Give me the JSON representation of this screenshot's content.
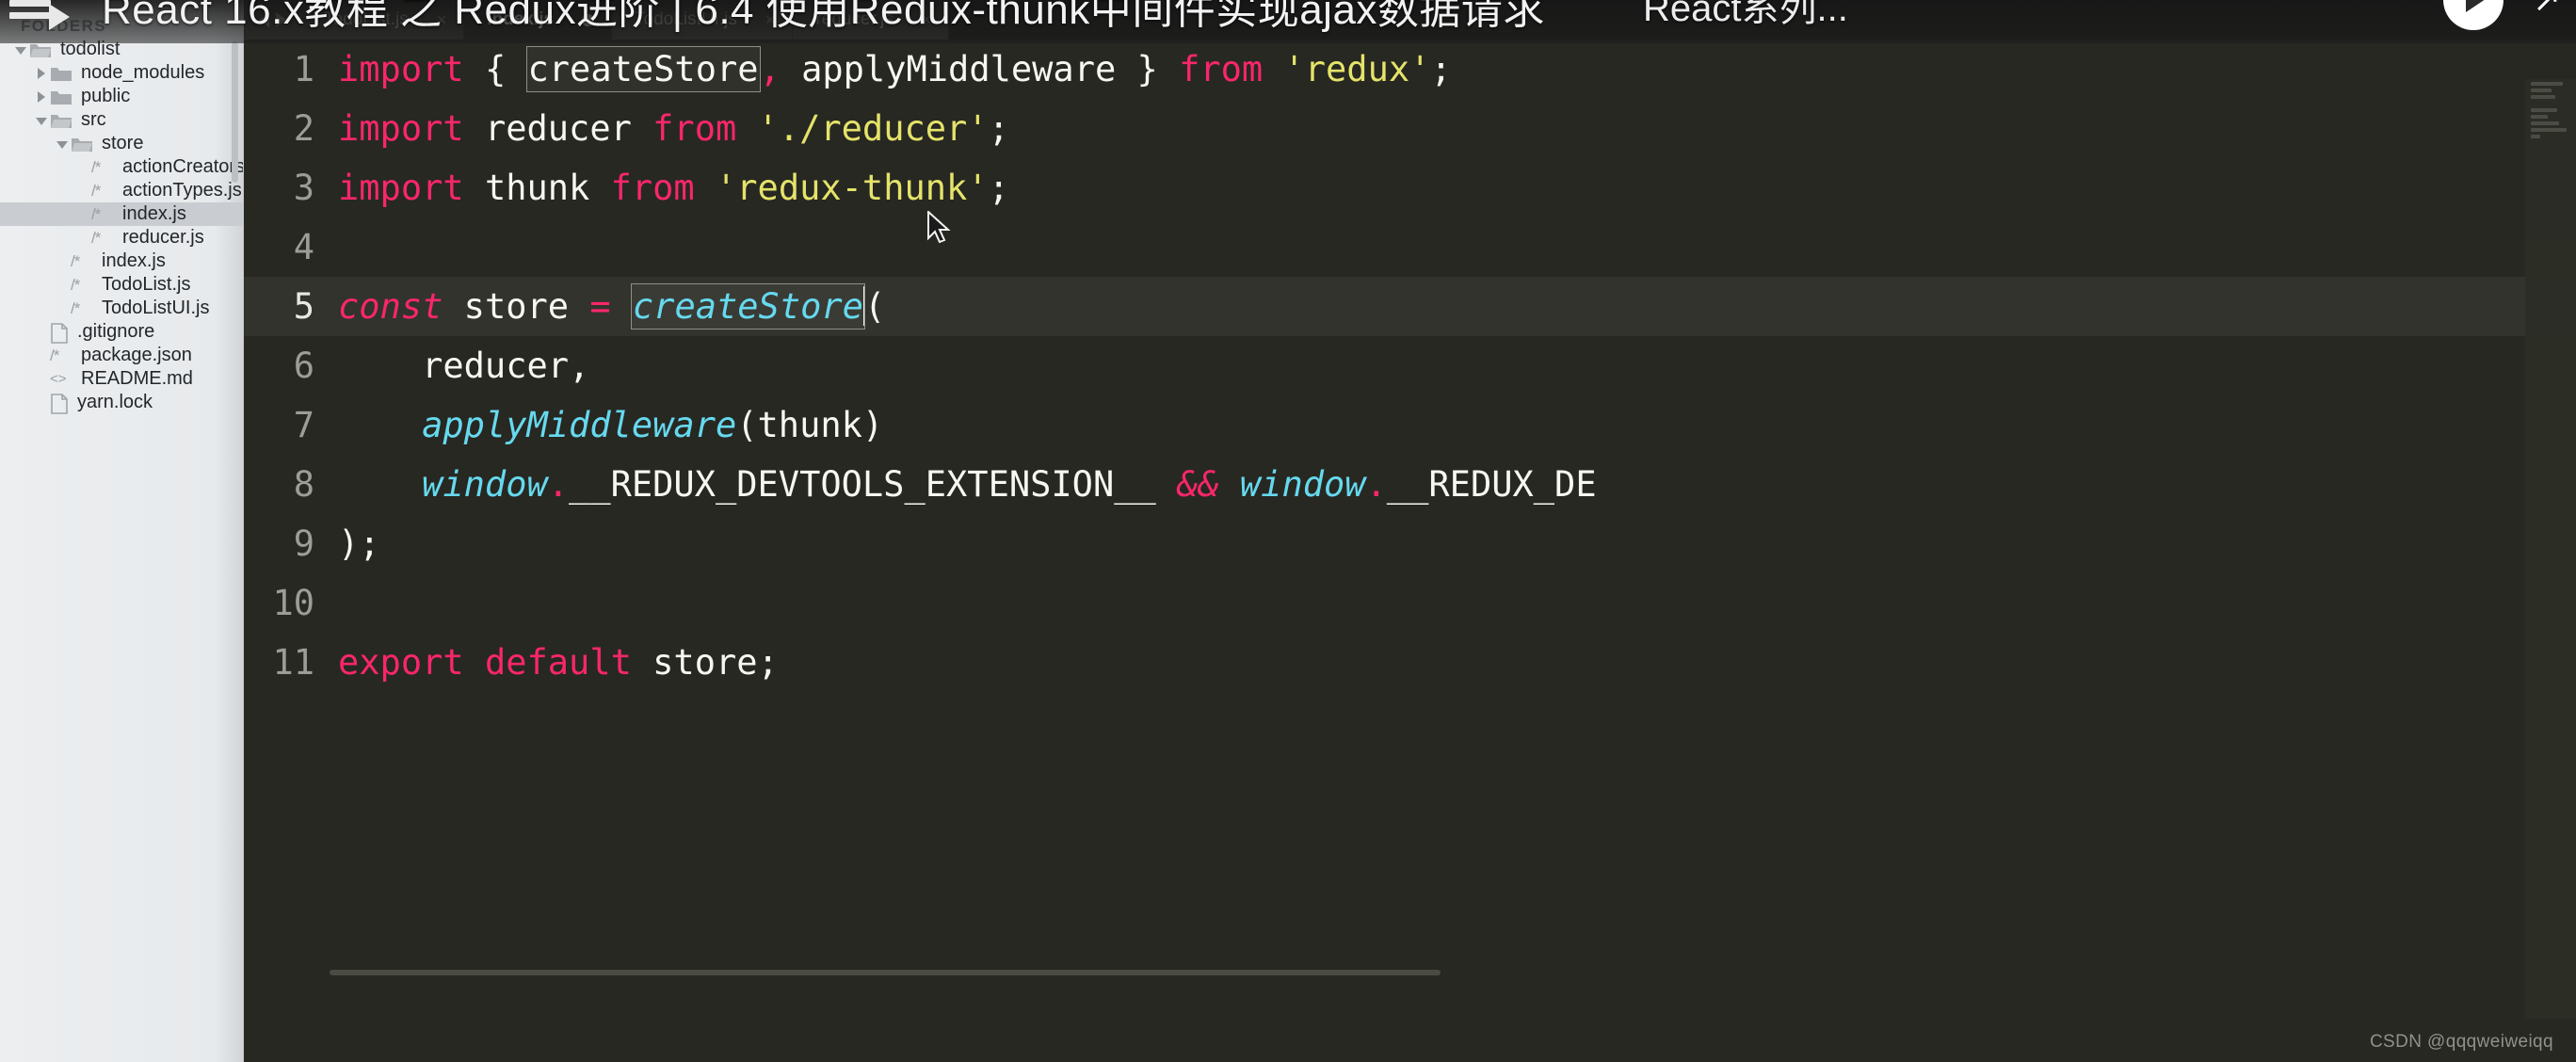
{
  "video": {
    "title": "React 16.x教程 之 Redux进阶 | 6.4 使用Redux-thunk中间件实现ajax数据请求",
    "channel_label": "React系列...",
    "menu_icon": "playlist-menu-icon",
    "play_icon": "play-icon",
    "logo_icon": "youtube-logo-icon",
    "cast_icon": "cast-icon"
  },
  "sidebar": {
    "header": "FOLDERS",
    "tree": [
      {
        "label": "todolist",
        "indent": 0,
        "arrow": "down",
        "icon": "folder-open-icon",
        "selected": false
      },
      {
        "label": "node_modules",
        "indent": 1,
        "arrow": "right",
        "icon": "folder-closed-icon",
        "selected": false
      },
      {
        "label": "public",
        "indent": 1,
        "arrow": "right",
        "icon": "folder-closed-icon",
        "selected": false
      },
      {
        "label": "src",
        "indent": 1,
        "arrow": "down",
        "icon": "folder-open-icon",
        "selected": false
      },
      {
        "label": "store",
        "indent": 2,
        "arrow": "down",
        "icon": "folder-open-icon",
        "selected": false
      },
      {
        "label": "actionCreators.js",
        "indent": 3,
        "arrow": "none",
        "icon": "js-file-icon",
        "selected": false
      },
      {
        "label": "actionTypes.js",
        "indent": 3,
        "arrow": "none",
        "icon": "js-file-icon",
        "selected": false
      },
      {
        "label": "index.js",
        "indent": 3,
        "arrow": "none",
        "icon": "js-file-icon",
        "selected": true
      },
      {
        "label": "reducer.js",
        "indent": 3,
        "arrow": "none",
        "icon": "js-file-icon",
        "selected": false
      },
      {
        "label": "index.js",
        "indent": 2,
        "arrow": "none",
        "icon": "js-file-icon",
        "selected": false
      },
      {
        "label": "TodoList.js",
        "indent": 2,
        "arrow": "none",
        "icon": "js-file-icon",
        "selected": false
      },
      {
        "label": "TodoListUI.js",
        "indent": 2,
        "arrow": "none",
        "icon": "js-file-icon",
        "selected": false
      },
      {
        "label": ".gitignore",
        "indent": 1,
        "arrow": "none",
        "icon": "plain-file-icon",
        "selected": false
      },
      {
        "label": "package.json",
        "indent": 1,
        "arrow": "none",
        "icon": "js-file-icon",
        "selected": false
      },
      {
        "label": "README.md",
        "indent": 1,
        "arrow": "none",
        "icon": "markup-file-icon",
        "selected": false
      },
      {
        "label": "yarn.lock",
        "indent": 1,
        "arrow": "none",
        "icon": "plain-file-icon",
        "selected": false
      }
    ]
  },
  "editor": {
    "tabs": [
      {
        "name": "TodoList.js",
        "active": false,
        "dirty": false,
        "close": "×"
      },
      {
        "name": "index.js",
        "active": true,
        "dirty": true,
        "close": "×"
      },
      {
        "name": "TodoListUI.js",
        "active": false,
        "dirty": false,
        "close": "×"
      },
      {
        "name": "reducer.js",
        "active": false,
        "dirty": false,
        "close": "×"
      }
    ],
    "nav_prev_icon": "tab-prev-icon",
    "nav_next_icon": "tab-next-icon",
    "line_numbers": [
      "1",
      "2",
      "3",
      "4",
      "5",
      "6",
      "7",
      "8",
      "9",
      "10",
      "11"
    ],
    "current_line": 5,
    "selection_text": "createStore",
    "code_lines": [
      "import { createStore, applyMiddleware } from 'redux';",
      "import reducer from './reducer';",
      "import thunk from 'redux-thunk';",
      "",
      "const store = createStore(",
      "    reducer,",
      "    applyMiddleware(thunk)",
      "    window.__REDUX_DEVTOOLS_EXTENSION__ && window.__REDUX_DE",
      ");",
      "",
      "export default store;"
    ],
    "tokens": {
      "import": "import",
      "from": "from",
      "const": "const",
      "export": "export",
      "default": "default",
      "createStore": "createStore",
      "applyMiddleware": "applyMiddleware",
      "store": "store",
      "reducer": "reducer",
      "thunk": "thunk",
      "window": "window",
      "devtools_a": "__REDUX_DEVTOOLS_EXTENSION__",
      "devtools_b": "__REDUX_DE",
      "and": "&&",
      "str_redux": "'redux'",
      "str_reducer": "'./reducer'",
      "str_redux_thunk": "'redux-thunk'",
      "brace_open": "{",
      "brace_close": "}",
      "paren_open": "(",
      "paren_close": ")",
      "comma": ",",
      "semi": ";",
      "dot": ".",
      "eq": "="
    },
    "watermark": "CSDN @qqqweiweiqq"
  },
  "colors": {
    "editor_bg": "#272822",
    "tabbar_bg": "#1f211c",
    "tab_inactive_bg": "#3b3d37",
    "keyword": "#f9266c",
    "string": "#e5e36a",
    "function": "#66d9ef",
    "text": "#f7f7f2",
    "gutter_text": "#9c9e96",
    "sidebar_bg": "#eceef0",
    "sidebar_selected": "#c9ccd0"
  }
}
